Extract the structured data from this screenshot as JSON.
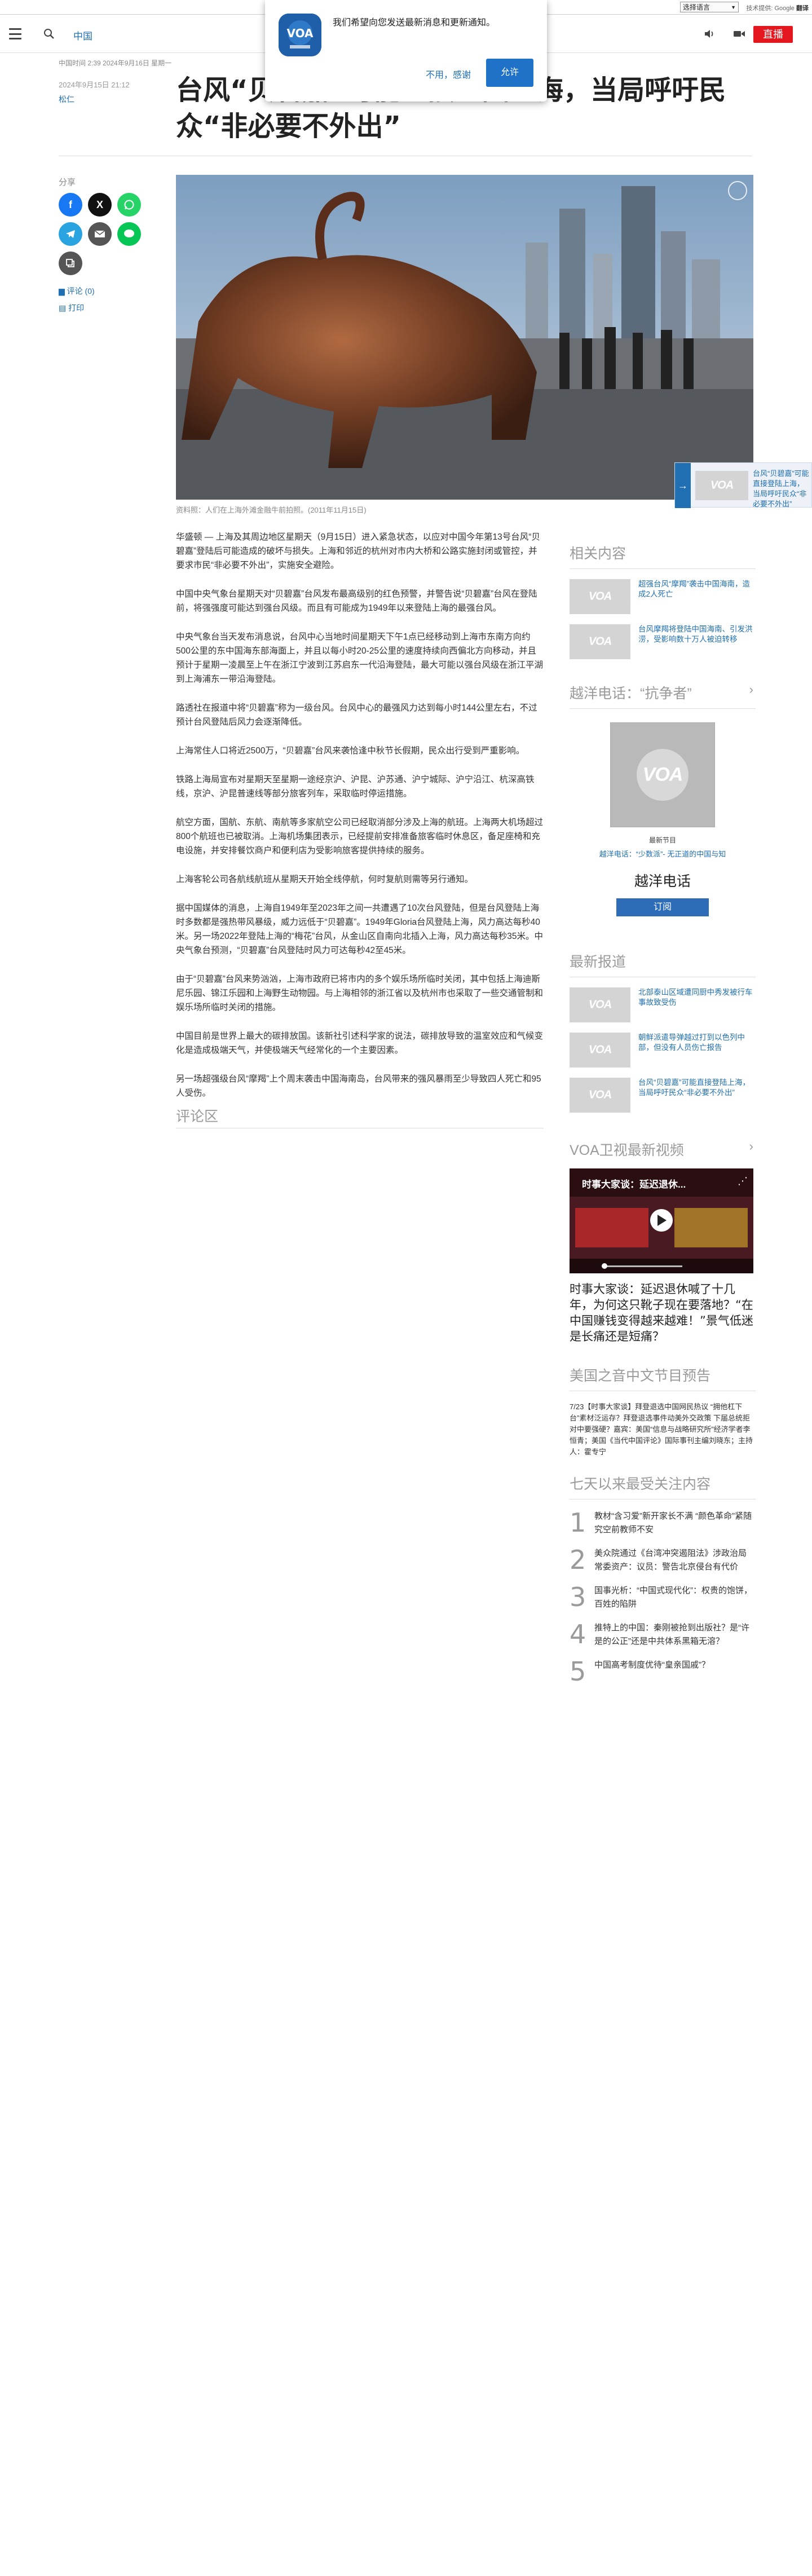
{
  "topbar": {
    "language_select": "选择语言",
    "powered_by": "技术提供:",
    "powered_brand": "Google",
    "translate": "翻译"
  },
  "nav": {
    "section": "中国",
    "live_label": "直播"
  },
  "notification": {
    "message": "我们希望向您发送最新消息和更新通知。",
    "deny": "不用，感谢",
    "allow": "允许"
  },
  "article": {
    "meta_line": "中国时间 2:39 2024年9月16日 星期一",
    "date": "2024年9月15日 21:12",
    "author": "松仁",
    "headline": "台风“贝碧嘉”可能直接登陆上海，当局呼吁民众“非必要不外出”",
    "share_label": "分享",
    "comments_link": "评论 (0)",
    "print_link": "打印",
    "caption": "资料照：人们在上海外滩金融牛前拍照。(2011年11月15日)",
    "paragraphs": [
      "华盛顿 — 上海及其周边地区星期天（9月15日）进入紧急状态，以应对中国今年第13号台风“贝碧嘉”登陆后可能造成的破坏与损失。上海和邻近的杭州对市内大桥和公路实施封闭或管控，并要求市民“非必要不外出”，实施安全避险。",
      "中国中央气象台星期天对“贝碧嘉”台风发布最高级别的红色预警，并警告说“贝碧嘉”台风在登陆前，将强强度可能达到强台风级。而且有可能成为1949年以来登陆上海的最强台风。",
      "中央气象台当天发布消息说，台风中心当地时间星期天下午1点已经移动到上海市东南方向约500公里的东中国海东部海面上，并且以每小时20-25公里的速度持续向西偏北方向移动，并且预计于星期一凌晨至上午在浙江宁波到江苏启东一代沿海登陆，最大可能以强台风级在浙江平湖到上海浦东一带沿海登陆。",
      "路透社在报道中将“贝碧嘉”称为一级台风。台风中心的最强风力达到每小时144公里左右，不过预计台风登陆后风力会逐渐降低。",
      "上海常住人口将近2500万，“贝碧嘉”台风来袭恰逢中秋节长假期，民众出行受到严重影响。",
      "铁路上海局宣布对星期天至星期一途经京沪、沪昆、沪苏通、沪宁城际、沪宁沿江、杭深高铁线，京沪、沪昆普速线等部分旅客列车，采取临时停运措施。",
      "航空方面，国航、东航、南航等多家航空公司已经取消部分涉及上海的航班。上海两大机场超过800个航班也已被取消。上海机场集团表示，已经提前安排准备旅客临时休息区，备足座椅和充电设施，并安排餐饮商户和便利店为受影响旅客提供持续的服务。",
      "上海客轮公司各航线航班从星期天开始全线停航，何时复航则需等另行通知。",
      "据中国媒体的消息，上海自1949年至2023年之间一共遭遇了10次台风登陆，但是台风登陆上海时多数都是强热带风暴级，威力远低于“贝碧嘉”。1949年Gloria台风登陆上海，风力高达每秒40米。另一场2022年登陆上海的“梅花”台风，从金山区自南向北插入上海，风力高达每秒35米。中央气象台预测，“贝碧嘉”台风登陆时风力可达每秒42至45米。",
      "由于“贝碧嘉”台风来势汹汹，上海市政府已将市内的多个娱乐场所临时关闭，其中包括上海迪斯尼乐园、锦江乐园和上海野生动物园。与上海相邻的浙江省以及杭州市也采取了一些交通管制和娱乐场所临时关闭的措施。",
      "中国目前是世界上最大的碳排放国。该新社引述科学家的说法，碳排放导致的温室效应和气候变化是造成极端天气，并使极端天气经常化的一个主要因素。",
      "另一场超强级台风“摩羯”上个周末袭击中国海南岛，台风带来的强风暴雨至少导致四人死亡和95人受伤。"
    ],
    "comments_heading": "评论区"
  },
  "floating_card": {
    "text": "台风“贝碧嘉”可能直接登陆上海，当局呼吁民众“非必要不外出”"
  },
  "sidebar": {
    "related": {
      "heading": "相关内容",
      "items": [
        "超强台风“摩羯”袭击中国海南，造成2人死亡",
        "台风摩羯将登陆中国海南、引发洪涝，受影响数十万人被迫转移"
      ]
    },
    "podcast": {
      "heading": "越洋电话：“抗争者”",
      "small_label": "最新节目",
      "episode": "越洋电话：“少数派”- 无正道的中国与知",
      "title": "越洋电话",
      "subscribe": "订阅"
    },
    "latest": {
      "heading": "最新报道",
      "items": [
        "北部泰山区域遭同厨中秀发被行车事故致受伤",
        "朝鲜派遣导弹越过打到以色列中部，但没有人员伤亡报告",
        "台风“贝碧嘉”可能直接登陆上海，当局呼吁民众“非必要不外出”"
      ]
    },
    "video": {
      "heading": "VOA卫视最新视频",
      "overlay_title": "时事大家谈：延迟退休...",
      "title": "时事大家谈：延迟退休喊了十几年，为何这只靴子现在要落地？“在中国赚钱变得越来越难！”景气低迷是长痛还是短痛？"
    },
    "preview": {
      "heading": "美国之音中文节目预告",
      "text": "7/23【时事大家谈】拜登退选中国网民热议 “拥他杠下台”素材泛运存？拜登退选事件动美外交政策 下届总统拒对中要强硬？嘉宾：美国“信息与战略研究所”经济学者李恒青；美国《当代中国评论》国际事刊主编刘晓东；主持人：霍专宁"
    },
    "ranking": {
      "heading": "七天以来最受关注内容",
      "items": [
        {
          "num": "1",
          "text": "教材“含习爱”新开家长不满 “颜色革命”紧随究空前教师不安"
        },
        {
          "num": "2",
          "text": "美众院通过《台湾冲突遏阻法》涉政治局常委资产：议员：警告北京侵台有代价"
        },
        {
          "num": "3",
          "text": "国事光析：“中国式现代化”：权贵的饱饼，百姓的陷阱"
        },
        {
          "num": "4",
          "text": "推特上的中国：秦刚被抢到出版社？是“许是的公正”还是中共体系黑箱无溶？"
        },
        {
          "num": "5",
          "text": "中国高考制度优待“皇亲国戚”？"
        }
      ]
    }
  }
}
